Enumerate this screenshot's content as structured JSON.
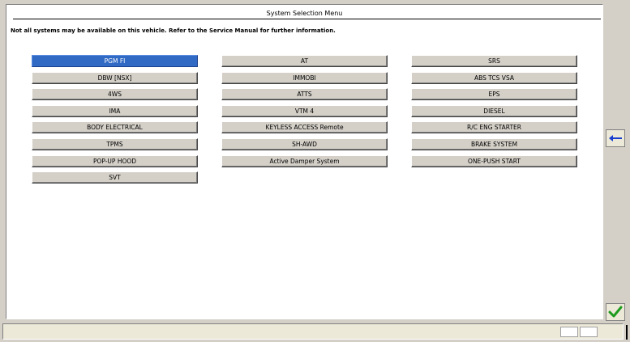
{
  "header": {
    "title": "System Selection Menu",
    "notice": "Not all systems may be available on this vehicle. Refer to the Service Manual for further information."
  },
  "systems": {
    "col1": [
      "PGM FI",
      "DBW [NSX]",
      "4WS",
      "IMA",
      "BODY ELECTRICAL",
      "TPMS",
      "POP-UP HOOD",
      "SVT"
    ],
    "col2": [
      "AT",
      "IMMOBI",
      "ATTS",
      "VTM 4",
      "KEYLESS ACCESS Remote",
      "SH-AWD",
      "Active Damper System"
    ],
    "col3": [
      "SRS",
      "ABS TCS VSA",
      "EPS",
      "DIESEL",
      "R/C ENG STARTER",
      "BRAKE SYSTEM",
      "ONE-PUSH START"
    ],
    "selected": "PGM FI"
  },
  "side_buttons": {
    "back_icon": "left-arrow-icon",
    "ok_icon": "checkmark-icon"
  },
  "colors": {
    "selected": "#316ac5",
    "back_arrow": "#1a3fd0",
    "check": "#1e9b1e"
  }
}
